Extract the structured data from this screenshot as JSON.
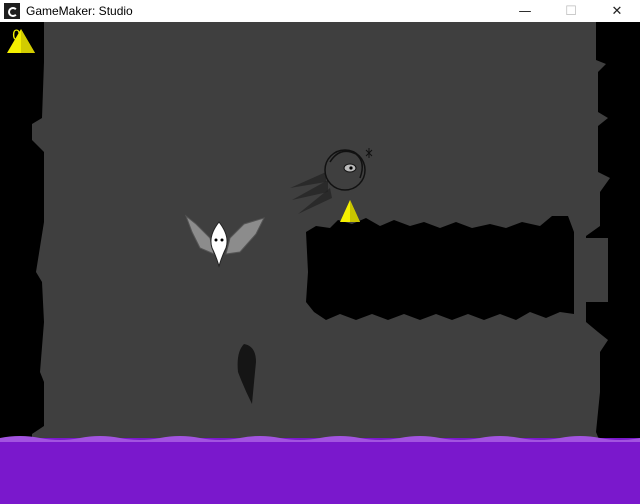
{
  "window": {
    "title": "GameMaker: Studio",
    "minimize_glyph": "—",
    "maximize_glyph": "☐",
    "close_glyph": "✕"
  },
  "hud": {
    "icon": "yellow-triangle-gem-icon",
    "gem_count": "0"
  },
  "colors": {
    "cave_wall": "#000000",
    "cave_floor": "#3f3f3f",
    "acid": "#7a18cc",
    "gem": "#f5f000",
    "hud_text": "#f0f000"
  }
}
